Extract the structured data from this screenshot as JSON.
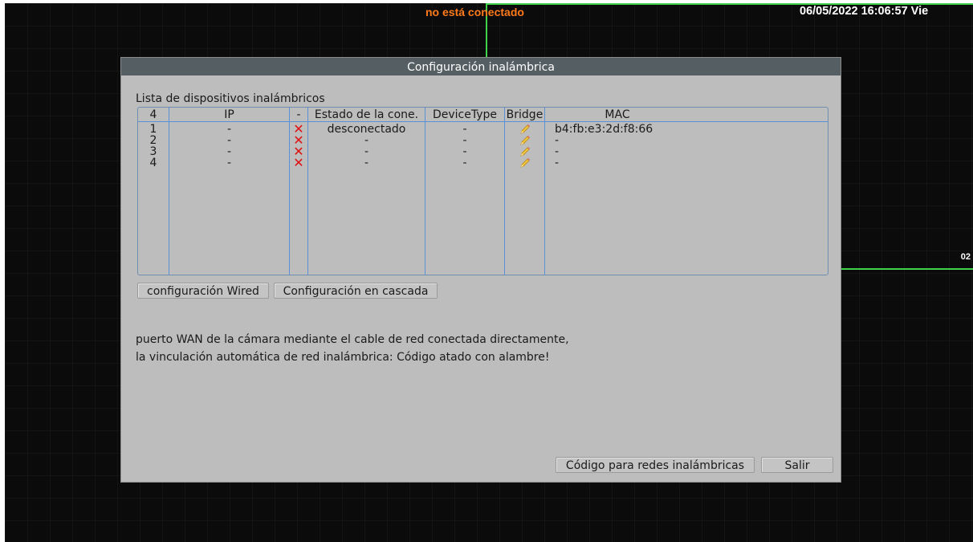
{
  "osd": {
    "status": "no está conectado",
    "datetime": "06/05/2022 16:06:57 Vie",
    "channel": "02",
    "border_color": "#3fd24a",
    "status_color": "#ff7a1a"
  },
  "dialog": {
    "title": "Configuración inalámbrica",
    "list_label": "Lista de dispositivos inalámbricos",
    "table": {
      "columns": [
        "4",
        "IP",
        "-",
        "Estado de la cone.",
        "DeviceType",
        "Bridge",
        "MAC"
      ],
      "rows": [
        {
          "num": "1",
          "ip": "-",
          "x_icon": "delete-icon",
          "state": "desconectado",
          "type": "-",
          "bridge_icon": "pencil-icon",
          "mac": "b4:fb:e3:2d:f8:66"
        },
        {
          "num": "2",
          "ip": "-",
          "x_icon": "delete-icon",
          "state": "-",
          "type": "-",
          "bridge_icon": "pencil-icon",
          "mac": "-"
        },
        {
          "num": "3",
          "ip": "-",
          "x_icon": "delete-icon",
          "state": "-",
          "type": "-",
          "bridge_icon": "pencil-icon",
          "mac": "-"
        },
        {
          "num": "4",
          "ip": "-",
          "x_icon": "delete-icon",
          "state": "-",
          "type": "-",
          "bridge_icon": "pencil-icon",
          "mac": "-"
        }
      ]
    },
    "buttons": {
      "wired": "configuración Wired",
      "cascade": "Configuración en cascada",
      "wireless_code": "Código para redes inalámbricas",
      "exit": "Salir"
    },
    "info": "puerto WAN de la cámara mediante el cable de red conectada directamente, la vinculación automática de red inalámbrica: Código atado con alambre!"
  }
}
